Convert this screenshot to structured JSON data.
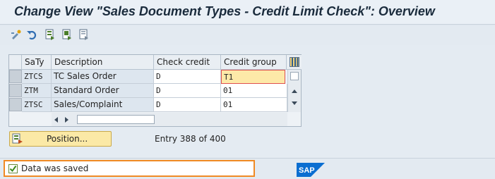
{
  "window": {
    "title": "Change View \"Sales Document Types - Credit Limit Check\": Overview"
  },
  "toolbar": {
    "buttons": [
      {
        "name": "display-change-icon"
      },
      {
        "name": "undo-icon"
      },
      {
        "name": "select-all-icon"
      },
      {
        "name": "select-block-icon"
      },
      {
        "name": "deselect-all-icon"
      }
    ]
  },
  "table": {
    "columns": [
      "SaTy",
      "Description",
      "Check credit",
      "Credit group"
    ],
    "rows": [
      {
        "saty": "ZTCS",
        "description": "TC Sales Order",
        "check_credit": "D",
        "credit_group": "T1"
      },
      {
        "saty": "ZTM",
        "description": "Standard Order",
        "check_credit": "D",
        "credit_group": "01"
      },
      {
        "saty": "ZTSC",
        "description": "Sales/Complaint",
        "check_credit": "D",
        "credit_group": "01"
      }
    ]
  },
  "position_button": {
    "label": "Position..."
  },
  "entry_info": "Entry 388 of 400",
  "status": {
    "message": "Data was saved",
    "type": "success"
  },
  "colors": {
    "accent_orange": "#f08a24",
    "button_yellow": "#fbe9a6",
    "focus_cell": "#fde9a8",
    "sap_blue": "#0a6ed1"
  },
  "logo": "SAP"
}
